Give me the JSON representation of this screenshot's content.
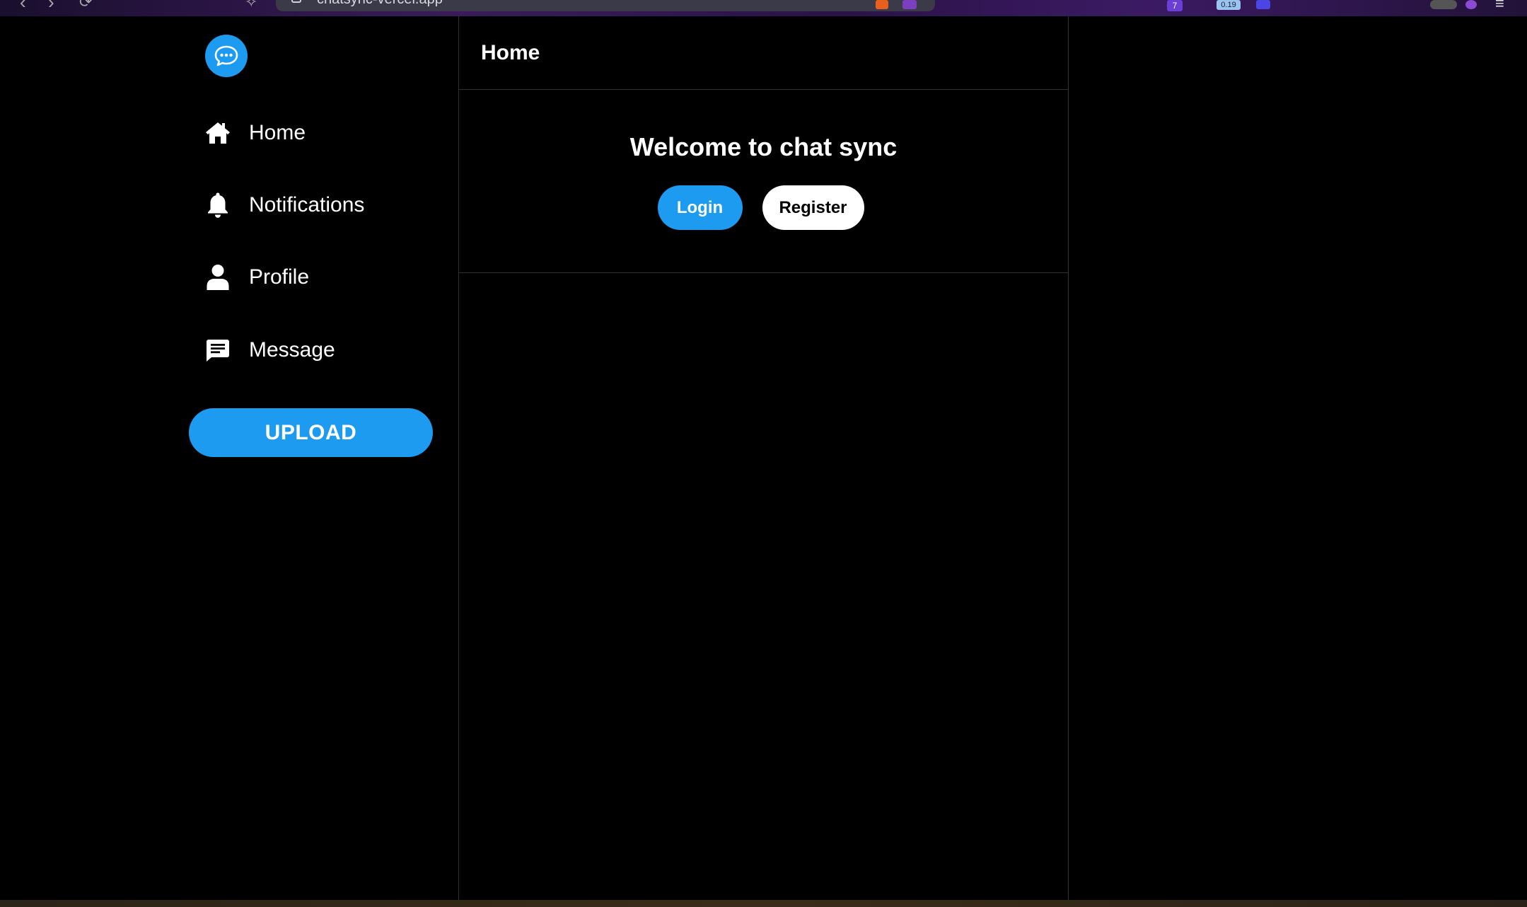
{
  "browser": {
    "url": "chatsync-vercel.app",
    "badge_count": "7",
    "extension_value": "0.19"
  },
  "sidebar": {
    "logo_icon": "chat-bubble-icon",
    "items": [
      {
        "label": "Home",
        "icon": "home-icon"
      },
      {
        "label": "Notifications",
        "icon": "bell-icon"
      },
      {
        "label": "Profile",
        "icon": "user-icon"
      },
      {
        "label": "Message",
        "icon": "message-icon"
      }
    ],
    "upload_label": "UPLOAD"
  },
  "main": {
    "title": "Home",
    "welcome": "Welcome to chat sync",
    "login_label": "Login",
    "register_label": "Register"
  },
  "colors": {
    "accent": "#1d9bf0",
    "background": "#000000",
    "border": "#2f3336"
  }
}
